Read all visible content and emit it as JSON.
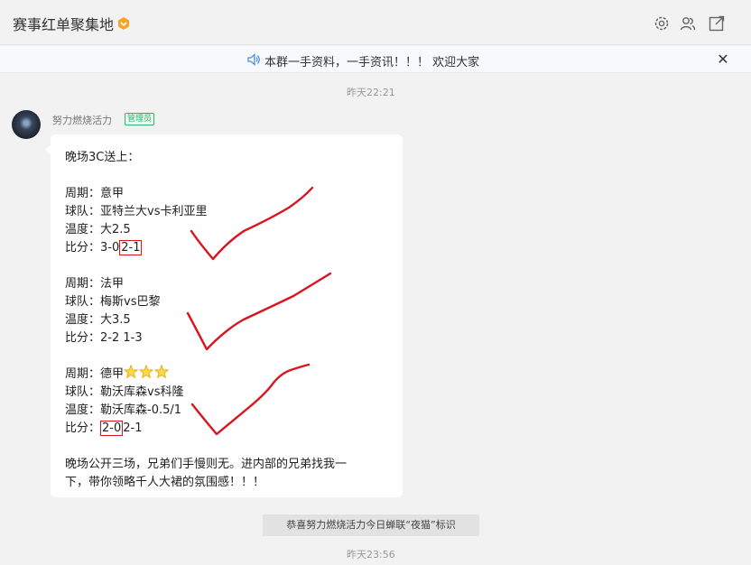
{
  "header": {
    "title": "赛事红单聚集地",
    "badge_icon": "hexagon-badge-icon",
    "icons": [
      "gear-icon",
      "members-icon",
      "share-icon"
    ]
  },
  "notice": {
    "text": "本群一手资料，一手资讯！！！ 欢迎大家",
    "close": "✕"
  },
  "messages": {
    "time1": "昨天22:21",
    "sender": "努力燃烧活力",
    "role": "管理员",
    "body": {
      "intro": "晚场3C送上：",
      "match1": {
        "period": "周期：意甲",
        "teams": "球队：亚特兰大vs卡利亚里",
        "temp": "温度：大2.5",
        "score_prefix": "比分：3-0",
        "score_boxed": "2-1"
      },
      "match2": {
        "period": "周期：法甲",
        "teams": "球队：梅斯vs巴黎",
        "temp": "温度：大3.5",
        "score": "比分：2-2 1-3"
      },
      "match3": {
        "period": "周期：德甲",
        "teams": "球队：勒沃库森vs科隆",
        "temp": "温度：勒沃库森-0.5/1",
        "score_prefix": "比分：",
        "score_boxed": "2-0",
        "score_suffix": "2-1",
        "stars": 3
      },
      "outro1": "晚场公开三场，兄弟们手慢则无。进内部的兄弟找我一",
      "outro2": "下，带你领略千人大裙的氛围感！！！"
    },
    "system": "恭喜努力燃烧活力今日蝉联“夜猫”标识",
    "time2": "昨天23:56"
  },
  "colors": {
    "check": "#d9141c",
    "admin_badge": "#2fb76b",
    "bubble": "#ffffff"
  }
}
